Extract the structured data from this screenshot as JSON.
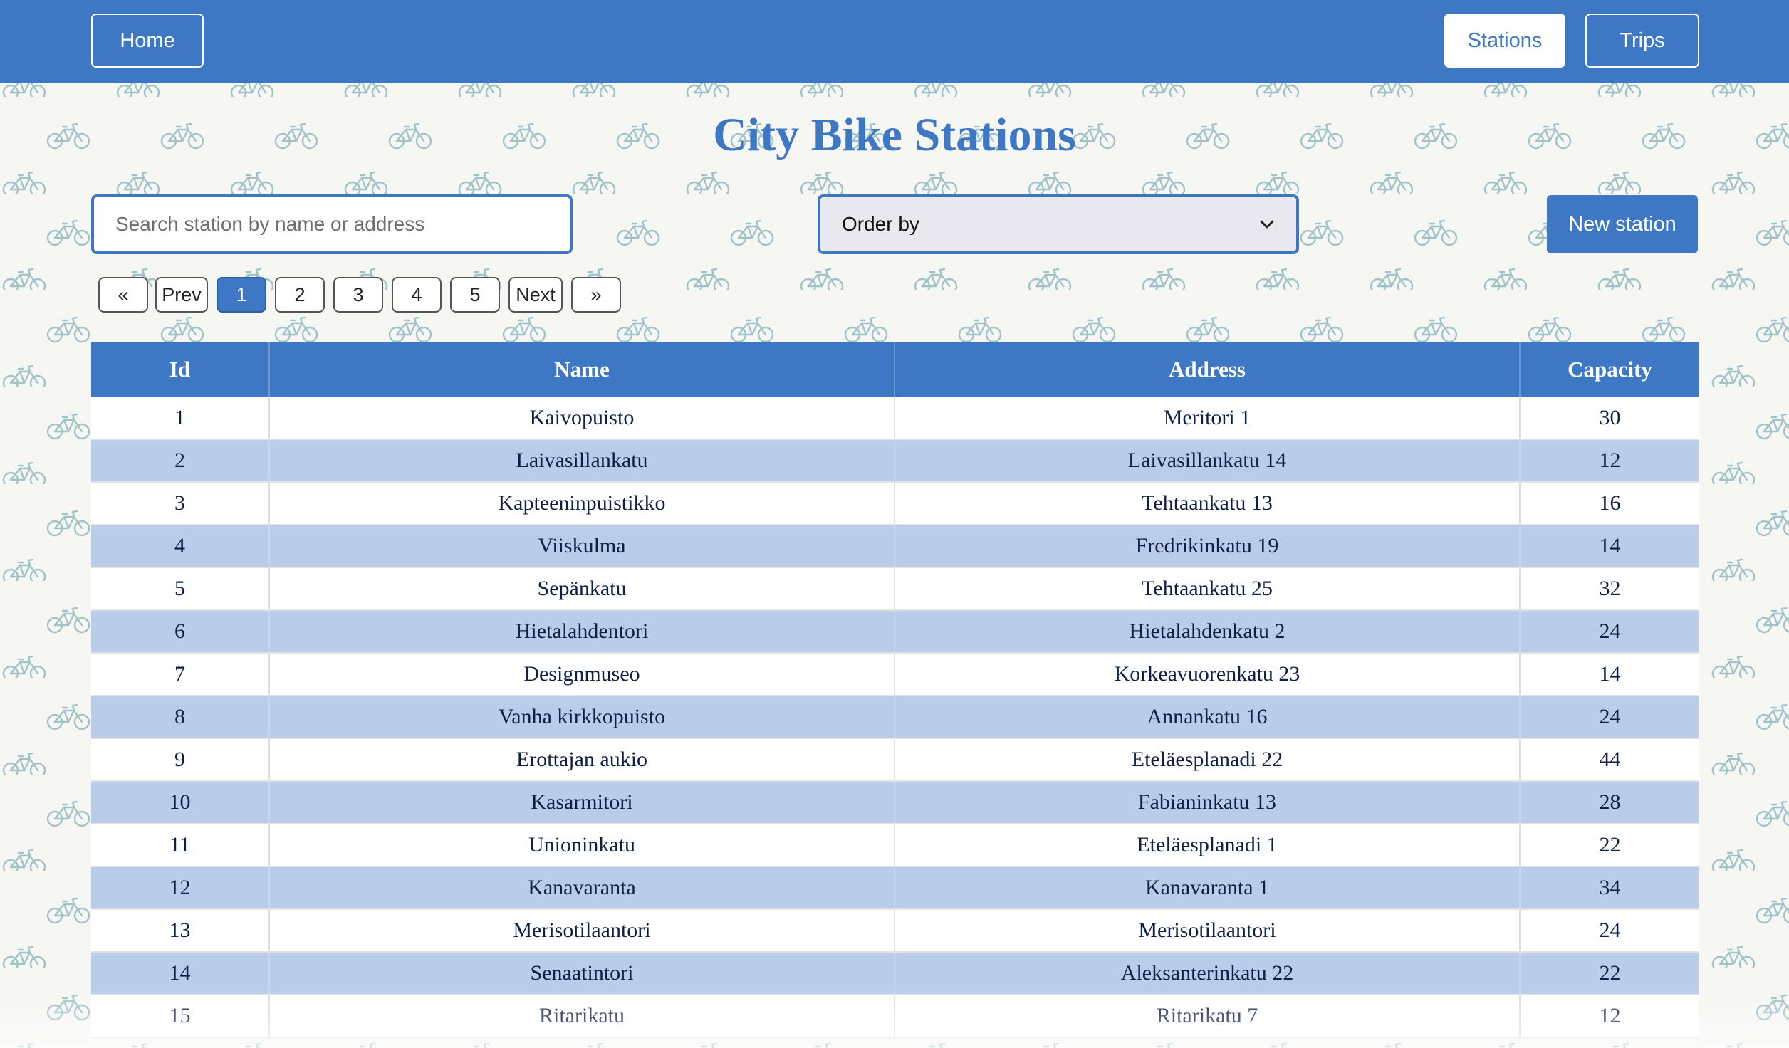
{
  "navbar": {
    "home_label": "Home",
    "stations_label": "Stations",
    "trips_label": "Trips"
  },
  "page_title": "City Bike Stations",
  "search": {
    "placeholder": "Search station by name or address",
    "value": ""
  },
  "order_select": {
    "selected": "Order by"
  },
  "new_station_label": "New station",
  "pagination": {
    "first": "«",
    "prev": "Prev",
    "pages": [
      "1",
      "2",
      "3",
      "4",
      "5"
    ],
    "active_page": "1",
    "next": "Next",
    "last": "»"
  },
  "table": {
    "headers": [
      "Id",
      "Name",
      "Address",
      "Capacity"
    ],
    "rows": [
      [
        "1",
        "Kaivopuisto",
        "Meritori 1",
        "30"
      ],
      [
        "2",
        "Laivasillankatu",
        "Laivasillankatu 14",
        "12"
      ],
      [
        "3",
        "Kapteeninpuistikko",
        "Tehtaankatu 13",
        "16"
      ],
      [
        "4",
        "Viiskulma",
        "Fredrikinkatu 19",
        "14"
      ],
      [
        "5",
        "Sepänkatu",
        "Tehtaankatu 25",
        "32"
      ],
      [
        "6",
        "Hietalahdentori",
        "Hietalahdenkatu 2",
        "24"
      ],
      [
        "7",
        "Designmuseo",
        "Korkeavuorenkatu 23",
        "14"
      ],
      [
        "8",
        "Vanha kirkkopuisto",
        "Annankatu 16",
        "24"
      ],
      [
        "9",
        "Erottajan aukio",
        "Eteläesplanadi 22",
        "44"
      ],
      [
        "10",
        "Kasarmitori",
        "Fabianinkatu 13",
        "28"
      ],
      [
        "11",
        "Unioninkatu",
        "Eteläesplanadi 1",
        "22"
      ],
      [
        "12",
        "Kanavaranta",
        "Kanavaranta 1",
        "34"
      ],
      [
        "13",
        "Merisotilaantori",
        "Merisotilaantori",
        "24"
      ],
      [
        "14",
        "Senaatintori",
        "Aleksanterinkatu 22",
        "22"
      ],
      [
        "15",
        "Ritarikatu",
        "Ritarikatu 7",
        "12"
      ]
    ]
  },
  "colors": {
    "primary": "#3e78c4",
    "row_alt": "#b9cdea",
    "background": "#f6f6f3",
    "bike_pattern": "#9fc3c8"
  },
  "icons": {
    "background_pattern": "bicycle-icon",
    "select_arrow": "chevron-down-icon"
  }
}
